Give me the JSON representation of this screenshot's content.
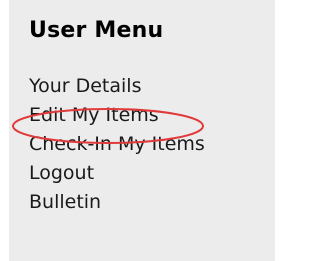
{
  "user_menu": {
    "title": "User Menu",
    "items": [
      {
        "label": "Your Details"
      },
      {
        "label": "Edit My Items"
      },
      {
        "label": "Check-In My Items"
      },
      {
        "label": "Logout"
      },
      {
        "label": "Bulletin"
      }
    ]
  },
  "colors": {
    "panel_background": "#ececec",
    "highlight_ellipse": "#e03a3a"
  }
}
